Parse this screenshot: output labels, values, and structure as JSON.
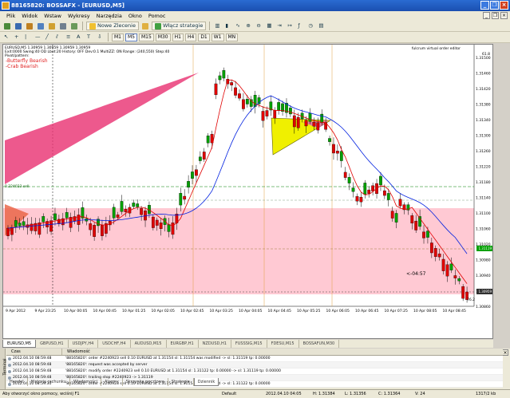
{
  "window": {
    "title": "88165820: BOSSAFX - [EURUSD,M5]"
  },
  "menu": {
    "items": [
      "Plik",
      "Widok",
      "Wstaw",
      "Wykresy",
      "Narzędzia",
      "Okno",
      "Pomoc"
    ]
  },
  "toolbar1": {
    "new_order": "Nowe Zlecenie",
    "strategies": "Włącz strategie"
  },
  "timeframes": [
    "M1",
    "M5",
    "M15",
    "M30",
    "H1",
    "H4",
    "D1",
    "W1",
    "MN"
  ],
  "timeframe_active": "M5",
  "chart": {
    "info_line1": "EURUSD,M5  1.30959 1.30959 1.30959 1.30959",
    "info_line2": "Exit:0000 Swing:40 OD Lbot:20 History: OFF Dev:0.1 MultiZZ: ON Range: (240,550) Step:40",
    "info_line3": "Pivot/pattern:",
    "patterns": [
      "-Butterfly Bearish",
      "-Crab Bearish"
    ],
    "top_right_text": "fulcrum virtual order editor",
    "scale_top_value": "61.8",
    "green_label": "0.224023 sell",
    "timer": "<-04:57",
    "bottom_pct": "76.2",
    "price_labels": [
      "1.31500",
      "1.31460",
      "1.31420",
      "1.31380",
      "1.31340",
      "1.31300",
      "1.31260",
      "1.31220",
      "1.31180",
      "1.31140",
      "1.31100",
      "1.31060",
      "1.31020",
      "1.30980",
      "1.30940",
      "1.30900",
      "1.30860"
    ],
    "time_labels": [
      "9 Apr 2012",
      "9 Apr 23:25",
      "10 Apr 00:05",
      "10 Apr 00:45",
      "10 Apr 01:25",
      "10 Apr 02:05",
      "10 Apr 02:45",
      "10 Apr 03:25",
      "10 Apr 04:05",
      "10 Apr 04:45",
      "10 Apr 05:25",
      "10 Apr 06:05",
      "10 Apr 06:45",
      "10 Apr 07:25",
      "10 Apr 08:05",
      "10 Apr 08:45"
    ],
    "price_tag_green": "1.31119",
    "price_tag_dark": "1.30959",
    "colors": {
      "bull": "#00a000",
      "bear": "#e00000",
      "ma_red": "#e00000",
      "ma_blue": "#0020e0",
      "pink_zone": "#ffc0cb",
      "triangle_fill": "#f0f000"
    }
  },
  "symbol_tabs": [
    "EURUSD,M5",
    "GBPUSD,H1",
    "USDJPY,H4",
    "USDCHF,H4",
    "AUDUSD,M15",
    "EURGBP,H1",
    "NZDUSD,H1",
    "FUSSSIG,M15",
    "FDESU,M15",
    "BOSSAFUN,M30"
  ],
  "symbol_tab_active": "EURUSD,M5",
  "terminal": {
    "side_label": "Terminal",
    "headers": {
      "time": "Czas",
      "message": "Wiadomość"
    },
    "rows": [
      {
        "time": "2012.04.10 08:59:48",
        "message": "'88165820': order #2240923 sell 0.10 EURUSD at 1.31154 sl: 1.31154 was modified -> sl: 1.31119 tp: 0.00000"
      },
      {
        "time": "2012.04.10 08:59:48",
        "message": "'88165820': request was accepted by server"
      },
      {
        "time": "2012.04.10 08:59:48",
        "message": "'88165820': modify order #2240923 sell 0.10 EURUSD at 1.31154 sl: 1.31122 tp: 0.00000 -> sl: 1.31119 tp: 0.00000"
      },
      {
        "time": "2012.04.10 08:59:48",
        "message": "'88165820': trailing stop #2240923 -> 1.31119"
      },
      {
        "time": "2012.04.10 08:59:30",
        "message": "'88165820': order #2240923 sell 0.10 EURUSD at 1.31154 sl: 1.31154 was modified -> sl: 1.31122 tp: 0.00000"
      }
    ],
    "tabs": [
      "Handel",
      "Historia rachunku",
      "Wiadomości",
      "Alarmy",
      "Skrzynka pocztowa",
      "Strategie",
      "Dziennik"
    ],
    "active_tab": "Dziennik"
  },
  "status": {
    "help": "Aby otworzyć okno pomocy, wciśnij F1",
    "profile": "Default",
    "datetime": "2012.04.10 04:05",
    "high": "H: 1.31384",
    "low": "L: 1.31356",
    "close": "C: 1.31364",
    "volume": "V: 24",
    "traffic": "1317/2 kb"
  }
}
